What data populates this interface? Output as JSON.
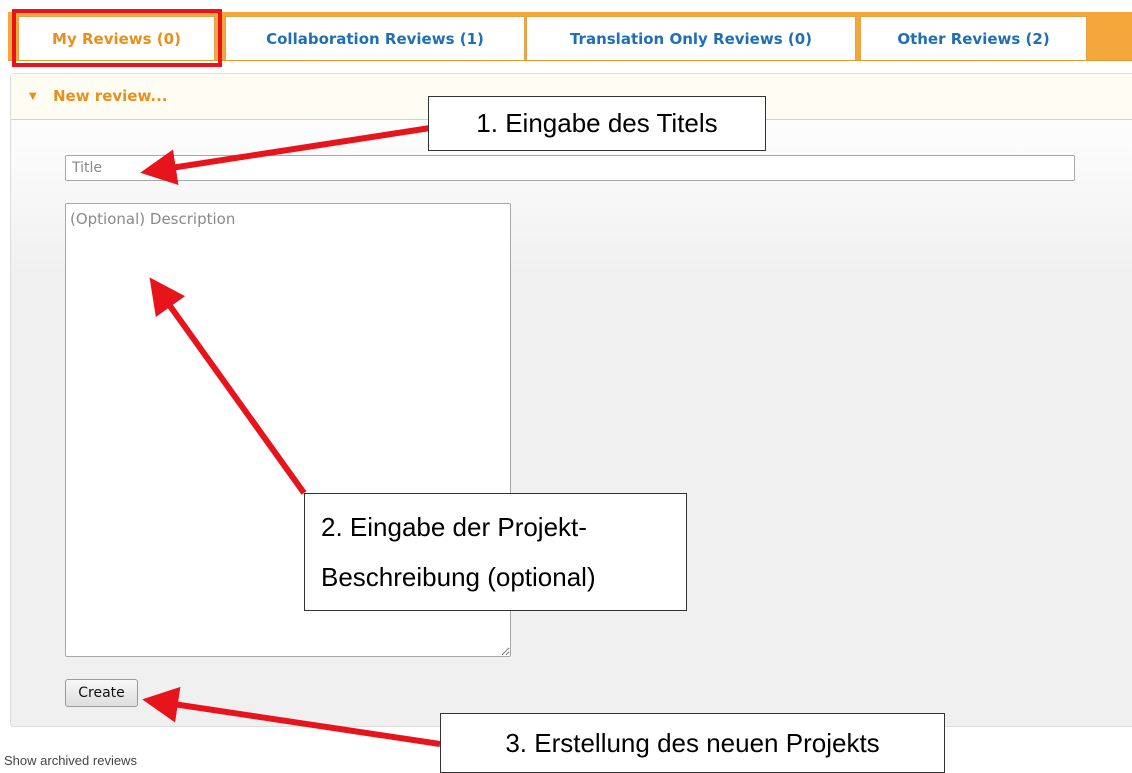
{
  "tabs": [
    {
      "label": "My Reviews (0)",
      "active": true
    },
    {
      "label": "Collaboration Reviews (1)",
      "active": false
    },
    {
      "label": "Translation Only Reviews (0)",
      "active": false
    },
    {
      "label": "Other Reviews (2)",
      "active": false
    }
  ],
  "panel": {
    "header_label": "New review...",
    "title_placeholder": "Title",
    "description_placeholder": "(Optional) Description",
    "create_label": "Create"
  },
  "footer": {
    "archived_link": "Show archived reviews"
  },
  "annotations": {
    "step1": "1. Eingabe des Titels",
    "step2_line1": "2. Eingabe der Projekt-",
    "step2_line2": "Beschreibung (optional)",
    "step3": "3. Erstellung des neuen Projekts"
  },
  "colors": {
    "tab_bar": "#f4a73a",
    "tab_text": "#1f6fb5",
    "active_tab_text": "#e8901a",
    "highlight_box": "#e8141b",
    "arrow": "#e8141b"
  }
}
